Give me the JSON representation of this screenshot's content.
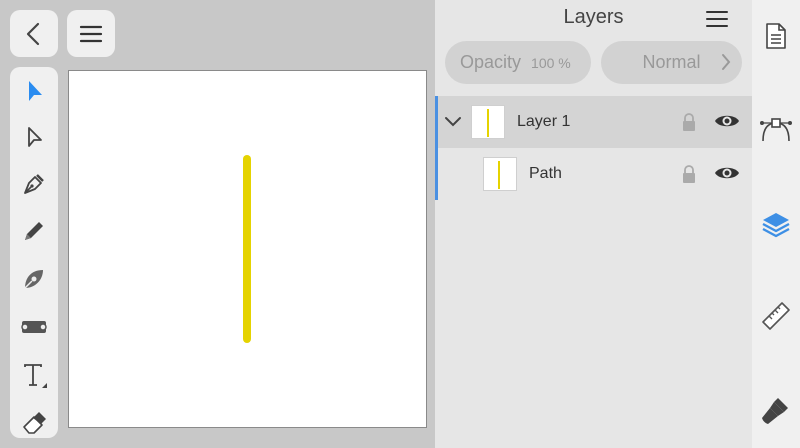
{
  "top": {
    "back_icon": "chevron-left-icon",
    "menu_icon": "hamburger-menu-icon"
  },
  "tools": [
    {
      "name": "move-tool",
      "icon": "arrow-pointer-icon",
      "active": true
    },
    {
      "name": "node-tool",
      "icon": "hollow-arrow-icon",
      "active": false
    },
    {
      "name": "pen-tool",
      "icon": "pen-nib-icon",
      "active": false
    },
    {
      "name": "pencil-tool",
      "icon": "pencil-icon",
      "active": false
    },
    {
      "name": "vector-brush-tool",
      "icon": "vector-brush-icon",
      "active": false
    },
    {
      "name": "fill-tool",
      "icon": "gradient-fill-icon",
      "active": false
    },
    {
      "name": "text-tool",
      "icon": "text-icon",
      "active": false
    },
    {
      "name": "eraser-tool",
      "icon": "eraser-icon",
      "active": false
    }
  ],
  "canvas": {
    "stroke_color": "#e5d300"
  },
  "layers_panel": {
    "title": "Layers",
    "opacity_label": "Opacity",
    "opacity_value": "100 %",
    "blend_mode": "Normal",
    "layers": [
      {
        "name": "Layer 1",
        "expanded": true,
        "selected": true
      },
      {
        "name": "Path",
        "expanded": false,
        "selected": false
      }
    ]
  },
  "right_rail": [
    {
      "name": "document-icon"
    },
    {
      "name": "bezier-curve-icon"
    },
    {
      "name": "layers-icon",
      "active": true
    },
    {
      "name": "ruler-icon"
    },
    {
      "name": "brush-icon"
    }
  ],
  "colors": {
    "accent": "#3d8fe5",
    "selection_marker": "#4a90e2"
  }
}
